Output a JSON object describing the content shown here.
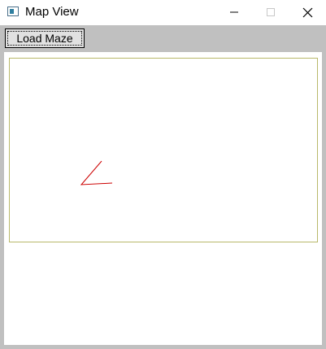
{
  "window": {
    "title": "Map View",
    "icon": "app-window-icon",
    "controls": {
      "minimize_icon": "minimize-icon",
      "maximize_icon": "maximize-icon",
      "close_icon": "close-icon"
    }
  },
  "toolbar": {
    "load_label": "Load Maze"
  },
  "map": {
    "stroke_color": "#cc0000",
    "border_color": "#b8b86a"
  }
}
